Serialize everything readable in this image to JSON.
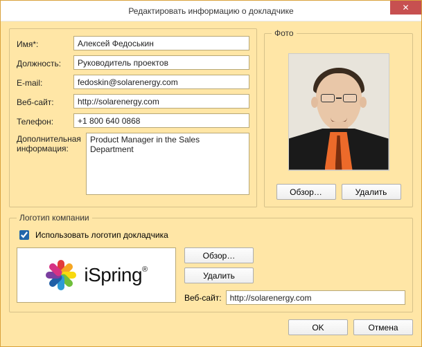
{
  "window": {
    "title": "Редактировать информацию о докладчике"
  },
  "form": {
    "name_label": "Имя*:",
    "name_value": "Алексей Федоськин",
    "position_label": "Должность:",
    "position_value": "Руководитель проектов",
    "email_label": "E-mail:",
    "email_value": "fedoskin@solarenergy.com",
    "website_label": "Веб-сайт:",
    "website_value": "http://solarenergy.com",
    "phone_label": "Телефон:",
    "phone_value": "+1 800 640 0868",
    "info_label_line1": "Дополнительная",
    "info_label_line2": "информация:",
    "info_value": "Product Manager in the Sales Department"
  },
  "photo": {
    "legend": "Фото",
    "browse": "Обзор…",
    "delete": "Удалить"
  },
  "logo": {
    "legend": "Логотип компании",
    "use_presenter_logo": "Использовать логотип докладчика",
    "use_presenter_logo_checked": true,
    "browse": "Обзор…",
    "delete": "Удалить",
    "website_label": "Веб-сайт:",
    "website_value": "http://solarenergy.com",
    "brand_text": "iSpring"
  },
  "dialog": {
    "ok": "OK",
    "cancel": "Отмена"
  }
}
